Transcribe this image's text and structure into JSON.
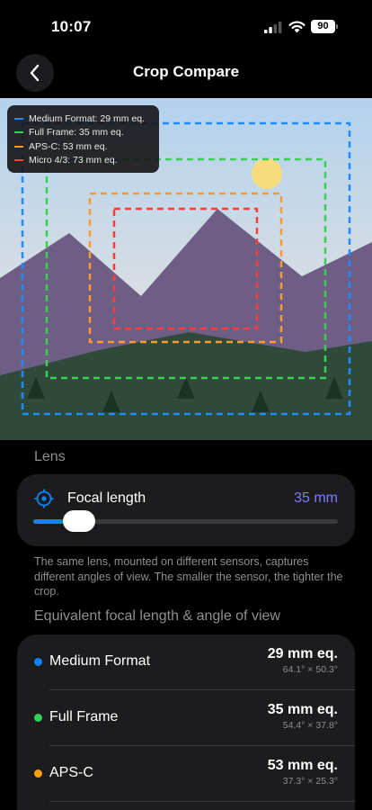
{
  "status": {
    "time": "10:07",
    "battery": "90"
  },
  "nav": {
    "title": "Crop Compare"
  },
  "legend": [
    {
      "label": "Medium Format: 29 mm eq.",
      "color": "#1e8cff"
    },
    {
      "label": "Full Frame: 35 mm eq.",
      "color": "#37d14f"
    },
    {
      "label": "APS-C: 53 mm eq.",
      "color": "#ff9a2e"
    },
    {
      "label": "Micro 4/3: 73 mm eq.",
      "color": "#ff3b3b"
    }
  ],
  "lens": {
    "section_label": "Lens",
    "focal_label": "Focal length",
    "focal_value": "35 mm",
    "slider_fraction": 0.15,
    "accent": "#7c7cff"
  },
  "description": "The same lens, mounted on different sensors, captures different angles of view. The smaller the sensor, the tighter the crop.",
  "equivalents": {
    "section_label": "Equivalent focal length & angle of view",
    "items": [
      {
        "name": "Medium Format",
        "mm": "29 mm eq.",
        "angle": "64.1° × 50.3°",
        "color": "#0a84ff"
      },
      {
        "name": "Full Frame",
        "mm": "35 mm eq.",
        "angle": "54.4° × 37.8°",
        "color": "#30d158"
      },
      {
        "name": "APS-C",
        "mm": "53 mm eq.",
        "angle": "37.3° × 25.3°",
        "color": "#ff9f0a"
      }
    ]
  }
}
